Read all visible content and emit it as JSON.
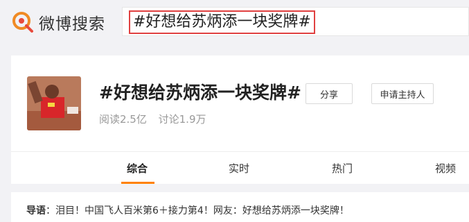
{
  "logo": {
    "text": "微博搜索"
  },
  "search": {
    "query": "#好想给苏炳添一块奖牌#"
  },
  "topic": {
    "title": "#好想给苏炳添一块奖牌#",
    "share_label": "分享",
    "host_label": "申请主持人",
    "reads": "阅读2.5亿",
    "discussions": "讨论1.9万"
  },
  "tabs": [
    {
      "label": "综合",
      "active": true
    },
    {
      "label": "实时"
    },
    {
      "label": "热门"
    },
    {
      "label": "视频"
    }
  ],
  "guide": {
    "label": "导语",
    "text": "泪目！中国飞人百米第6＋接力第4！网友：好想给苏炳添一块奖牌！"
  },
  "colors": {
    "accent": "#ff8200",
    "logo_orange": "#f08a24",
    "highlight_border": "#e04040"
  }
}
